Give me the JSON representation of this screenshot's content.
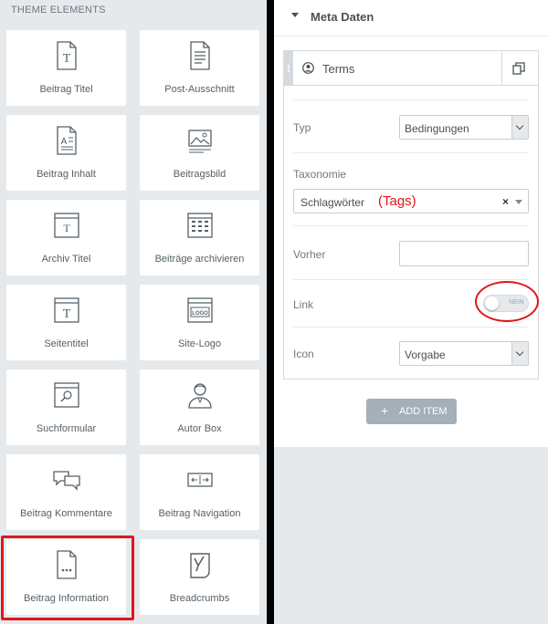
{
  "left_panel": {
    "section_title": "THEME ELEMENTS",
    "widgets": [
      {
        "label": "Beitrag Titel",
        "icon": "post-title-icon"
      },
      {
        "label": "Post-Ausschnitt",
        "icon": "post-excerpt-icon"
      },
      {
        "label": "Beitrag Inhalt",
        "icon": "post-content-icon"
      },
      {
        "label": "Beitragsbild",
        "icon": "featured-image-icon"
      },
      {
        "label": "Archiv Titel",
        "icon": "archive-title-icon"
      },
      {
        "label": "Beiträge archivieren",
        "icon": "archive-posts-icon"
      },
      {
        "label": "Seitentitel",
        "icon": "page-title-icon"
      },
      {
        "label": "Site-Logo",
        "icon": "site-logo-icon"
      },
      {
        "label": "Suchformular",
        "icon": "search-form-icon"
      },
      {
        "label": "Autor Box",
        "icon": "author-box-icon"
      },
      {
        "label": "Beitrag Kommentare",
        "icon": "post-comments-icon"
      },
      {
        "label": "Beitrag Navigation",
        "icon": "post-navigation-icon"
      },
      {
        "label": "Beitrag Information",
        "icon": "post-info-icon"
      },
      {
        "label": "Breadcrumbs",
        "icon": "breadcrumbs-icon"
      }
    ]
  },
  "right_panel": {
    "section_title": "Meta Daten",
    "repeater_item": {
      "title": "Terms",
      "fields": {
        "typ": {
          "label": "Typ",
          "value": "Bedingungen"
        },
        "taxonomie": {
          "label": "Taxonomie",
          "value": "Schlagwörter",
          "annotation": "(Tags)"
        },
        "vorher": {
          "label": "Vorher",
          "value": ""
        },
        "link": {
          "label": "Link",
          "toggle_text": "NEIN"
        },
        "icon": {
          "label": "Icon",
          "value": "Vorgabe"
        }
      }
    },
    "add_button": {
      "plus": "+",
      "label": "ADD ITEM"
    }
  },
  "colors": {
    "annotation_red": "#e0161a",
    "panel_bg": "#e6e9ec",
    "text": "#495157"
  }
}
